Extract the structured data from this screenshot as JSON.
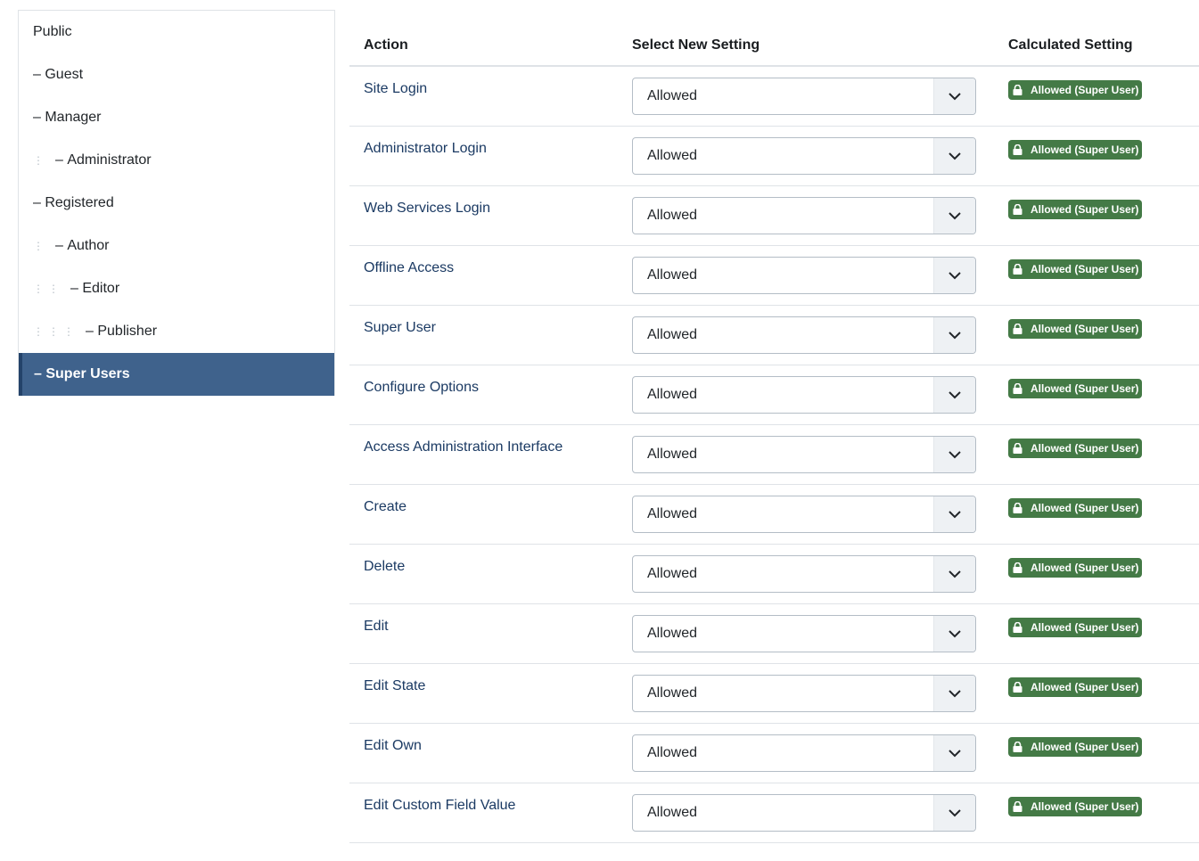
{
  "groups": [
    {
      "label": "Public",
      "depth": 0,
      "dots": 0,
      "dash": false,
      "active": false
    },
    {
      "label": "Guest",
      "depth": 1,
      "dots": 0,
      "dash": true,
      "active": false
    },
    {
      "label": "Manager",
      "depth": 1,
      "dots": 0,
      "dash": true,
      "active": false
    },
    {
      "label": "Administrator",
      "depth": 2,
      "dots": 1,
      "dash": true,
      "active": false
    },
    {
      "label": "Registered",
      "depth": 1,
      "dots": 0,
      "dash": true,
      "active": false
    },
    {
      "label": "Author",
      "depth": 2,
      "dots": 1,
      "dash": true,
      "active": false
    },
    {
      "label": "Editor",
      "depth": 3,
      "dots": 2,
      "dash": true,
      "active": false
    },
    {
      "label": "Publisher",
      "depth": 4,
      "dots": 3,
      "dash": true,
      "active": false
    },
    {
      "label": "Super Users",
      "depth": 1,
      "dots": 0,
      "dash": true,
      "active": true
    }
  ],
  "table": {
    "headers": {
      "action": "Action",
      "select": "Select New Setting",
      "calculated": "Calculated Setting"
    },
    "rows": [
      {
        "action": "Site Login",
        "setting": "Allowed",
        "calculated": "Allowed (Super User)"
      },
      {
        "action": "Administrator Login",
        "setting": "Allowed",
        "calculated": "Allowed (Super User)"
      },
      {
        "action": "Web Services Login",
        "setting": "Allowed",
        "calculated": "Allowed (Super User)"
      },
      {
        "action": "Offline Access",
        "setting": "Allowed",
        "calculated": "Allowed (Super User)"
      },
      {
        "action": "Super User",
        "setting": "Allowed",
        "calculated": "Allowed (Super User)"
      },
      {
        "action": "Configure Options",
        "setting": "Allowed",
        "calculated": "Allowed (Super User)"
      },
      {
        "action": "Access Administration Interface",
        "setting": "Allowed",
        "calculated": "Allowed (Super User)"
      },
      {
        "action": "Create",
        "setting": "Allowed",
        "calculated": "Allowed (Super User)"
      },
      {
        "action": "Delete",
        "setting": "Allowed",
        "calculated": "Allowed (Super User)"
      },
      {
        "action": "Edit",
        "setting": "Allowed",
        "calculated": "Allowed (Super User)"
      },
      {
        "action": "Edit State",
        "setting": "Allowed",
        "calculated": "Allowed (Super User)"
      },
      {
        "action": "Edit Own",
        "setting": "Allowed",
        "calculated": "Allowed (Super User)"
      },
      {
        "action": "Edit Custom Field Value",
        "setting": "Allowed",
        "calculated": "Allowed (Super User)"
      }
    ]
  },
  "icons": {
    "badge": "lock-icon",
    "select": "chevron-down-icon"
  },
  "colors": {
    "active_group": "#3f628c",
    "badge": "#447a46",
    "link": "#1b3a63"
  }
}
